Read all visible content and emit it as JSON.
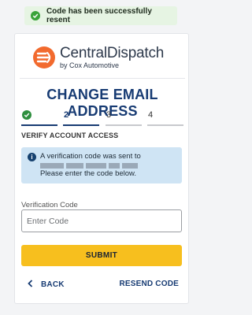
{
  "toast": {
    "message": "Code has been successfully resent"
  },
  "brand": {
    "name": "CentralDispatch",
    "tagline": "by Cox Automotive"
  },
  "page": {
    "title": "CHANGE EMAIL ADDRESS"
  },
  "steps": [
    {
      "label": "1",
      "status": "done"
    },
    {
      "label": "2",
      "status": "active"
    },
    {
      "label": "3",
      "status": "upcoming"
    },
    {
      "label": "4",
      "status": "upcoming"
    }
  ],
  "step_heading": "VERIFY ACCOUNT ACCESS",
  "info": {
    "line1": "A verification code was sent to",
    "line2": "Please enter the code below."
  },
  "form": {
    "code_label": "Verification Code",
    "code_placeholder": "Enter Code",
    "submit_label": "SUBMIT"
  },
  "footer": {
    "back_label": "BACK",
    "resend_label": "RESEND CODE"
  },
  "colors": {
    "primary": "#173b73",
    "accent_button": "#f7bf1e",
    "success": "#39a33a",
    "info_bg": "#cfe4f4",
    "logo_orange": "#f26a2e"
  }
}
